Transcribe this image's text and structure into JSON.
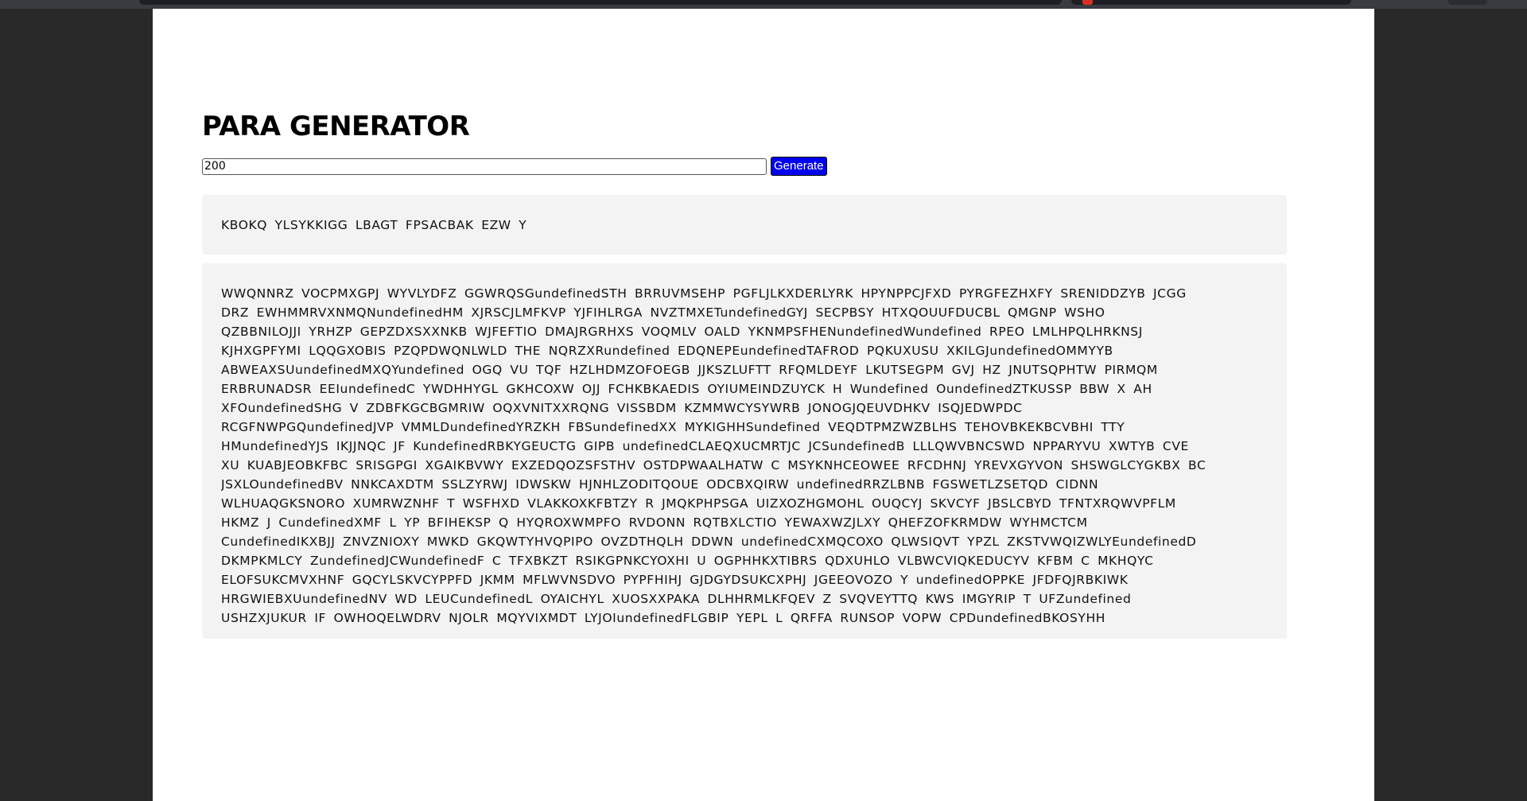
{
  "app": {
    "title": "PARA GENERATOR"
  },
  "controls": {
    "count_value": "200",
    "generate_label": "Generate"
  },
  "paragraphs": [
    [
      "KBOKQ YLSYKKIGG LBAGT FPSACBAK EZW Y"
    ],
    [
      "WWQNNRZ VOCPMXGPJ WYVLYDFZ GGWRQSGundefinedSTH BRRUVMSEHP PGFLJLKXDERLYRK HPYNPPCJFXD PYRGFEZHXFY SRENIDDZYB JCGG",
      "DRZ EWHMMRVXNMQNundefinedHM XJRSCJLMFKVP YJFIHLRGA NVZTMXETundefinedGYJ SECPBSY HTXQOUUFDUCBL QMGNP WSHO",
      "QZBBNILOJJI YRHZP GEPZDXSXXNKB WJFEFTIO DMAJRGRHXS VOQMLV OALD YKNMPSFHENundefinedWundefined RPEO LMLHPQLHRKNSJ",
      "KJHXGPFYMI LQQGXOBIS PZQPDWQNLWLD THE NQRZXRundefined EDQNEPEundefinedTAFROD PQKUXUSU XKILGJundefinedOMMYYB",
      "ABWEAXSUundefinedMXQYundefined OGQ VU TQF HZLHDMZOFOEGB JJKSZLUFTT RFQMLDEYF LKUTSEGPM GVJ HZ JNUTSQPHTW PIRMQM",
      "ERBRUNADSR EEIundefinedC YWDHHYGL GKHCOXW OJJ FCHKBKAEDIS OYIUMEINDZUYCK H Wundefined OundefinedZTKUSSP BBW X AH",
      "XFOundefinedSHG V ZDBFKGCBGMRIW OQXVNITXXRQNG VISSBDM KZMMWCYSYWRB JONOGJQEUVDHKV ISQJEDWPDC",
      "RCGFNWPGQundefinedJVP VMMLDundefinedYRZKH FBSundefinedXX MYKIGHHSundefined VEQDTPMZWZBLHS TEHOVBKEKBCVBHI TTY",
      "HMundefinedYJS IKJJNQC JF KundefinedRBKYGEUCTG GIPB undefinedCLAEQXUCMRTJC JCSundefinedB LLLQWVBNCSWD NPPARYVU XWTYB CVE",
      "XU KUABJEOBKFBC SRISGPGI XGAIKBVWY EXZEDQOZSFSTHV OSTDPWAALHATW C MSYKNHCEOWEE RFCDHNJ YREVXGYVON SHSWGLCYGKBX BC",
      "JSXLOundefinedBV NNKCAXDTM SSLZYRWJ IDWSKW HJNHLZODITQOUE ODCBXQIRW undefinedRRZLBNB FGSWETLZSETQD CIDNN",
      "WLHUAQGKSNORO XUMRWZNHF T WSFHXD VLAKKOXKFBTZY R JMQKPHPSGA UIZXOZHGMOHL OUQCYJ SKVCYF JBSLCBYD TFNTXRQWVPFLM",
      "HKMZ J CundefinedXMF L YP BFIHEKSP Q HYQROXWMPFO RVDONN RQTBXLCTIO YEWAXWZJLXY QHEFZOFKRMDW WYHMCTCM",
      "CundefinedIKXBJJ ZNVZNIOXY MWKD GKQWTYHVQPIPO OVZDTHQLH DDWN undefinedCXMQCOXO QLWSIQVT YPZL ZKSTVWQIZWLYEundefinedD",
      "DKMPKMLCY ZundefinedJCWundefinedF C TFXBKZT RSIKGPNKCYOXHI U OGPHHKXTIBRS QDXUHLO VLBWCVIQKEDUCYV KFBM C MKHQYC",
      "ELOFSUKCMVXHNF GQCYLSKVCYPPFD JKMM MFLWVNSDVO PYPFHIHJ GJDGYDSUKCXPHJ JGEEOVOZO Y undefinedOPPKE JFDFQJRBKIWK",
      "HRGWIEBXUundefinedNV WD LEUCundefinedL OYAICHYL XUOSXXPAKA DLHHRMLKFQEV Z SVQVEYTTQ KWS IMGYRIP T UFZundefined",
      "USHZXJUKUR IF OWHOQELWDRV NJOLR MQYVIXMDT LYJOIundefinedFLGBIP YEPL L QRFFA RUNSOP VOPW CPDundefinedBKOSYHH"
    ]
  ]
}
